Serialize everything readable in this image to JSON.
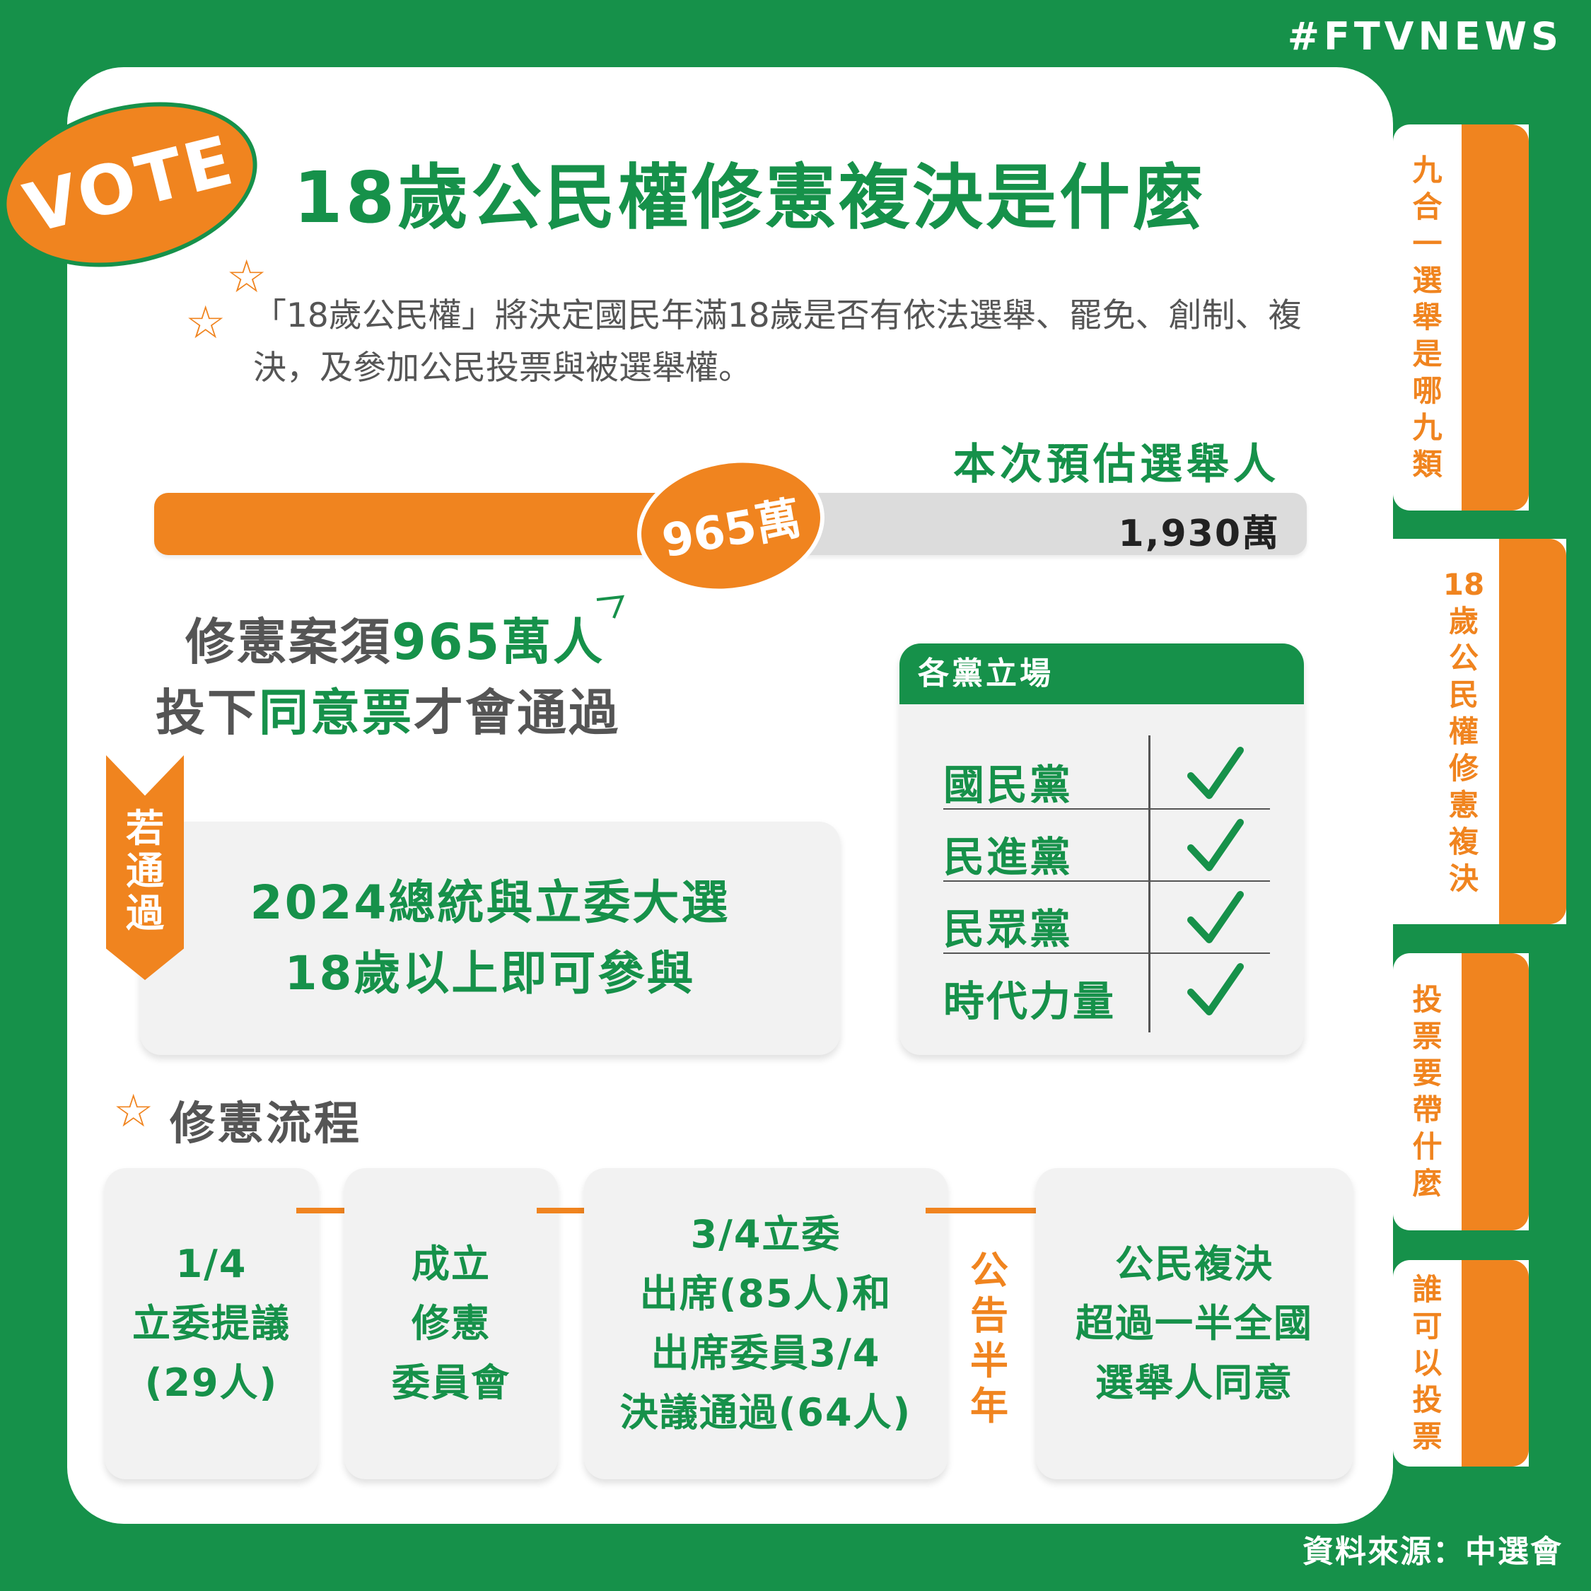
{
  "brand": "#FTVNEWS",
  "source": "資料來源：中選會",
  "colors": {
    "green": "#16914a",
    "orange": "#f0841f",
    "gray": "#f2f2f2"
  },
  "side_tabs": [
    {
      "label": "九合一選舉是哪九類"
    },
    {
      "label": "18歲公民權修憲複決"
    },
    {
      "label": "投票要帶什麼"
    },
    {
      "label": "誰可以投票"
    }
  ],
  "badge": "VOTE",
  "title": "18歲公民權修憲複決是什麼",
  "description": "「18歲公民權」將決定國民年滿18歲是否有依法選舉、罷免、創制、複決，及參加公民投票與被選舉權。",
  "electorate": {
    "label": "本次預估選舉人",
    "threshold_label": "965萬",
    "total_label": "1,930萬",
    "threshold_fraction": 0.5
  },
  "requirement": {
    "line1_prefix": "修憲案須",
    "line1_highlight": "965萬人",
    "line2_prefix": "投下",
    "line2_highlight": "同意票",
    "line2_suffix": "才會通過"
  },
  "if_pass": {
    "tag": "若通過",
    "line1": "2024總統與立委大選",
    "line2": "18歲以上即可參與"
  },
  "parties": {
    "header": "各黨立場",
    "rows": [
      {
        "name": "國民黨",
        "icon": "check-icon"
      },
      {
        "name": "民進黨",
        "icon": "check-icon"
      },
      {
        "name": "民眾黨",
        "icon": "check-icon"
      },
      {
        "name": "時代力量",
        "icon": "check-icon"
      }
    ]
  },
  "process": {
    "title": "修憲流程",
    "steps": [
      {
        "lines": [
          "1/4",
          "立委提議",
          "(29人)"
        ]
      },
      {
        "lines": [
          "成立",
          "修憲",
          "委員會"
        ]
      },
      {
        "lines": [
          "3/4立委",
          "出席(85人)和",
          "出席委員3/4",
          "決議通過(64人)"
        ]
      },
      {
        "lines": [
          "公民複決",
          "超過一半全國",
          "選舉人同意"
        ]
      }
    ],
    "announce": "公告半年"
  }
}
